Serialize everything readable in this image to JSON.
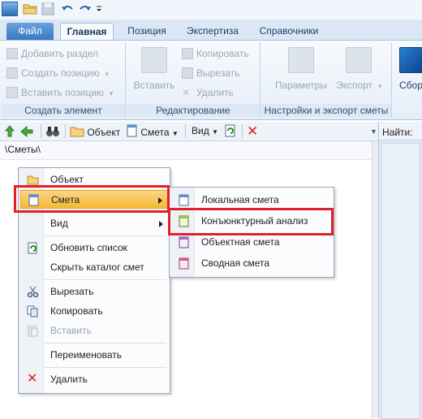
{
  "quick_access": {
    "icons": [
      "app-icon",
      "open-folder-icon",
      "save-icon",
      "undo-icon",
      "redo-icon",
      "customize-dropdown-icon"
    ]
  },
  "ribbon_tabs": {
    "file": "Файл",
    "home": "Главная",
    "position": "Позиция",
    "expertise": "Экспертиза",
    "references": "Справочники"
  },
  "ribbon": {
    "create_group": {
      "caption": "Создать элемент",
      "add_section": "Добавить раздел",
      "create_position": "Создать позицию",
      "insert_position": "Вставить позицию"
    },
    "edit_group": {
      "caption": "Редактирование",
      "paste": "Вставить",
      "copy": "Копировать",
      "cut": "Вырезать",
      "delete": "Удалить"
    },
    "settings_group": {
      "caption": "Настройки и экспорт сметы",
      "params": "Параметры",
      "export": "Экспорт"
    },
    "collection": "Сбор"
  },
  "toolbar": {
    "object": "Объект",
    "estimate": "Смета",
    "view": "Вид"
  },
  "breadcrumb": "\\Сметы\\",
  "right_panel": {
    "find_label": "Найти:"
  },
  "context_menu": {
    "items": [
      {
        "label": "Объект"
      },
      {
        "label": "Смета"
      },
      {
        "label": "Вид"
      },
      {
        "label": "Обновить список"
      },
      {
        "label": "Скрыть каталог смет"
      },
      {
        "label": "Вырезать"
      },
      {
        "label": "Копировать"
      },
      {
        "label": "Вставить"
      },
      {
        "label": "Переименовать"
      },
      {
        "label": "Удалить"
      }
    ]
  },
  "submenu": {
    "items": [
      {
        "label": "Локальная смета"
      },
      {
        "label": "Конъюнктурный анализ"
      },
      {
        "label": "Объектная смета"
      },
      {
        "label": "Сводная смета"
      }
    ]
  },
  "colors": {
    "highlight": "#f4b836",
    "annotation_red": "#e2202a",
    "accent_blue": "#3a78c2"
  }
}
